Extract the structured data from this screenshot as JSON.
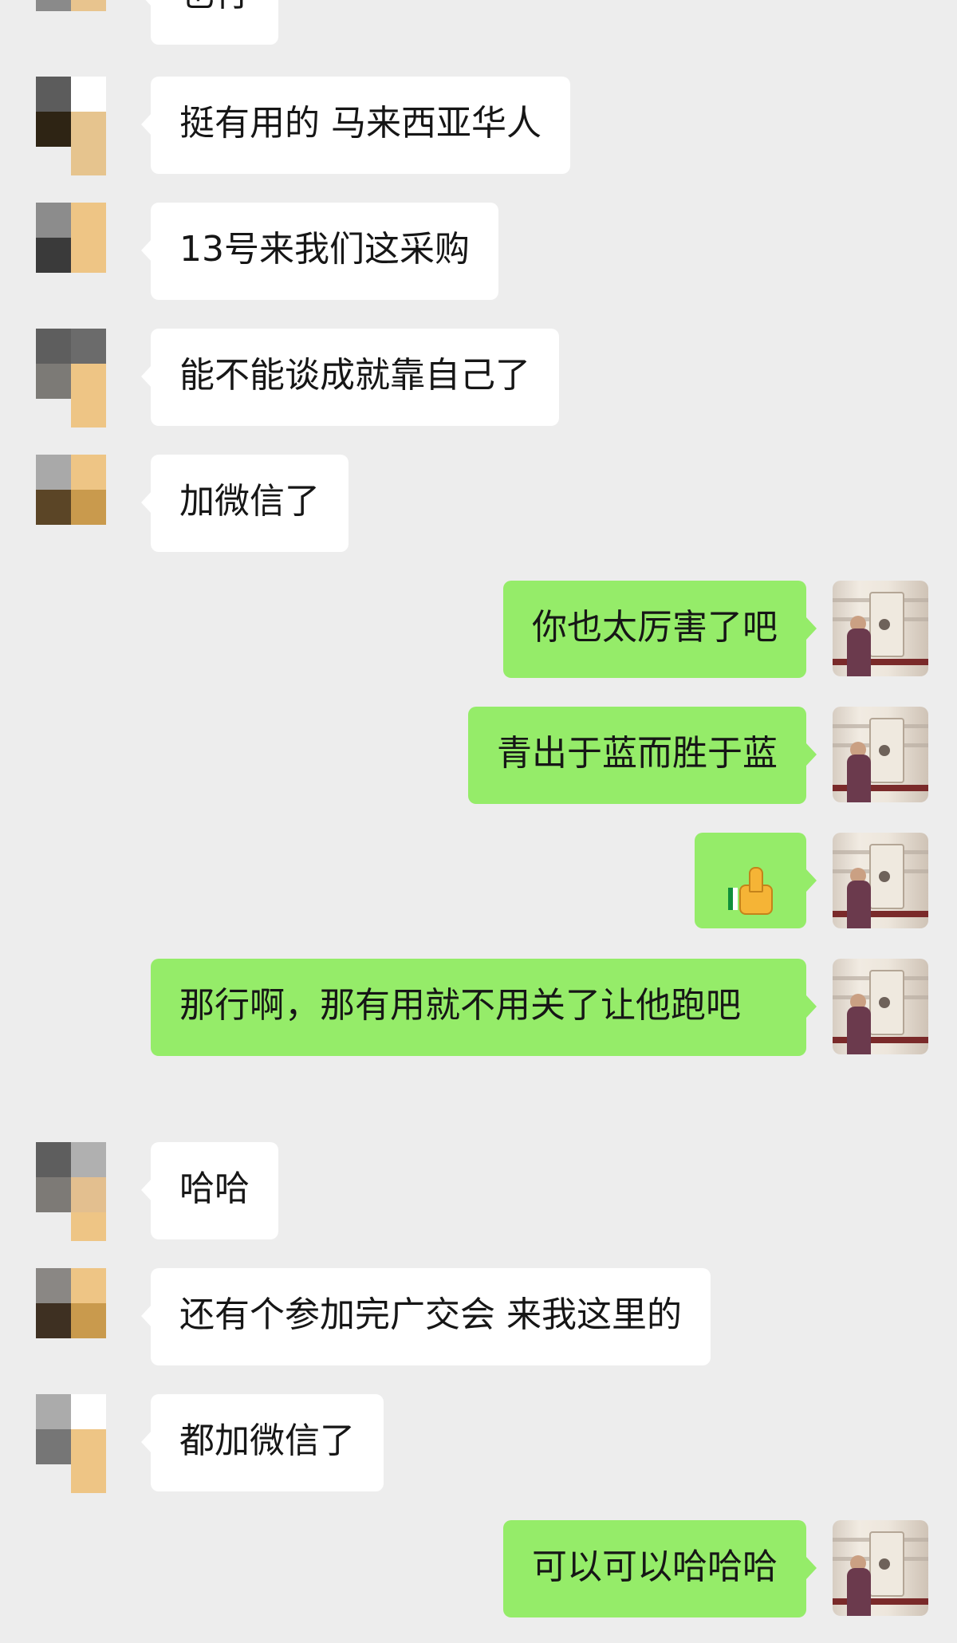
{
  "messages": [
    {
      "side": "in",
      "text": "也行"
    },
    {
      "side": "in",
      "text": "挺有用的  马来西亚华人"
    },
    {
      "side": "in",
      "text": "13号来我们这采购"
    },
    {
      "side": "in",
      "text": "能不能谈成就靠自己了"
    },
    {
      "side": "in",
      "text": "加微信了"
    },
    {
      "side": "out",
      "text": "你也太厉害了吧"
    },
    {
      "side": "out",
      "text": "青出于蓝而胜于蓝"
    },
    {
      "side": "out",
      "emoji": "thumbs-up-icon"
    },
    {
      "side": "out",
      "text": "那行啊，那有用就不用关了让他跑吧"
    },
    {
      "side": "in",
      "text": "哈哈"
    },
    {
      "side": "in",
      "text": "还有个参加完广交会 来我这里的"
    },
    {
      "side": "in",
      "text": "都加微信了"
    },
    {
      "side": "out",
      "text": "可以可以哈哈哈"
    }
  ],
  "colors": {
    "background": "#ededed",
    "incoming_bubble": "#ffffff",
    "outgoing_bubble": "#95ec69",
    "text": "#161616"
  }
}
